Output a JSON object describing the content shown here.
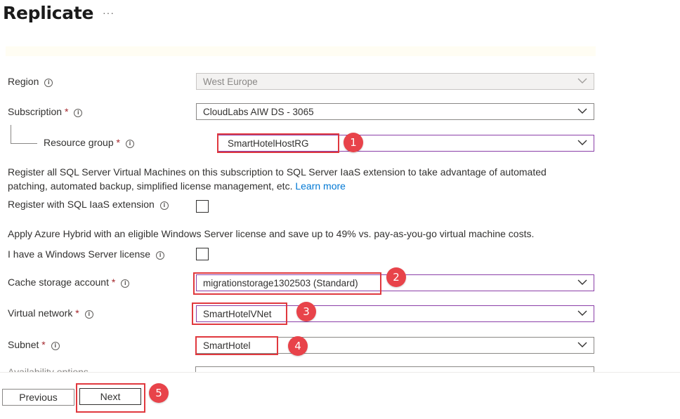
{
  "header": {
    "title": "Replicate",
    "more_label": "···"
  },
  "form": {
    "region": {
      "label": "Region",
      "value": "West Europe"
    },
    "subscription": {
      "label": "Subscription",
      "required": "*",
      "value": "CloudLabs AIW DS - 3065"
    },
    "resource_group": {
      "label": "Resource group",
      "required": "*",
      "value": "SmartHotelHostRG"
    },
    "sql_note": {
      "line1": "Register all SQL Server Virtual Machines on this subscription to SQL Server IaaS extension to take advantage of automated",
      "line2": "patching, automated backup, simplified license management, etc.",
      "link": "Learn more"
    },
    "sql_register": {
      "label": "Register with SQL IaaS extension",
      "checked": false
    },
    "hybrid_note": "Apply Azure Hybrid with an eligible Windows Server license and save up to 49% vs. pay-as-you-go virtual machine costs.",
    "windows_license": {
      "label": "I have a Windows Server license",
      "checked": false
    },
    "cache_storage": {
      "label": "Cache storage account",
      "required": "*",
      "value": "migrationstorage1302503 (Standard)"
    },
    "virtual_network": {
      "label": "Virtual network",
      "required": "*",
      "value": "SmartHotelVNet"
    },
    "subnet": {
      "label": "Subnet",
      "required": "*",
      "value": "SmartHotel"
    },
    "availability": {
      "label": "Availability options"
    }
  },
  "footer": {
    "previous_label": "Previous",
    "next_label": "Next"
  },
  "annotations": {
    "b1": "1",
    "b2": "2",
    "b3": "3",
    "b4": "4",
    "b5": "5"
  },
  "icons": {
    "info": "info-icon",
    "chevron": "chevron-down-icon"
  },
  "colors": {
    "annotation_red": "#e0383e",
    "focus_purple": "#8b3fa8",
    "link_blue": "#0078d4"
  }
}
